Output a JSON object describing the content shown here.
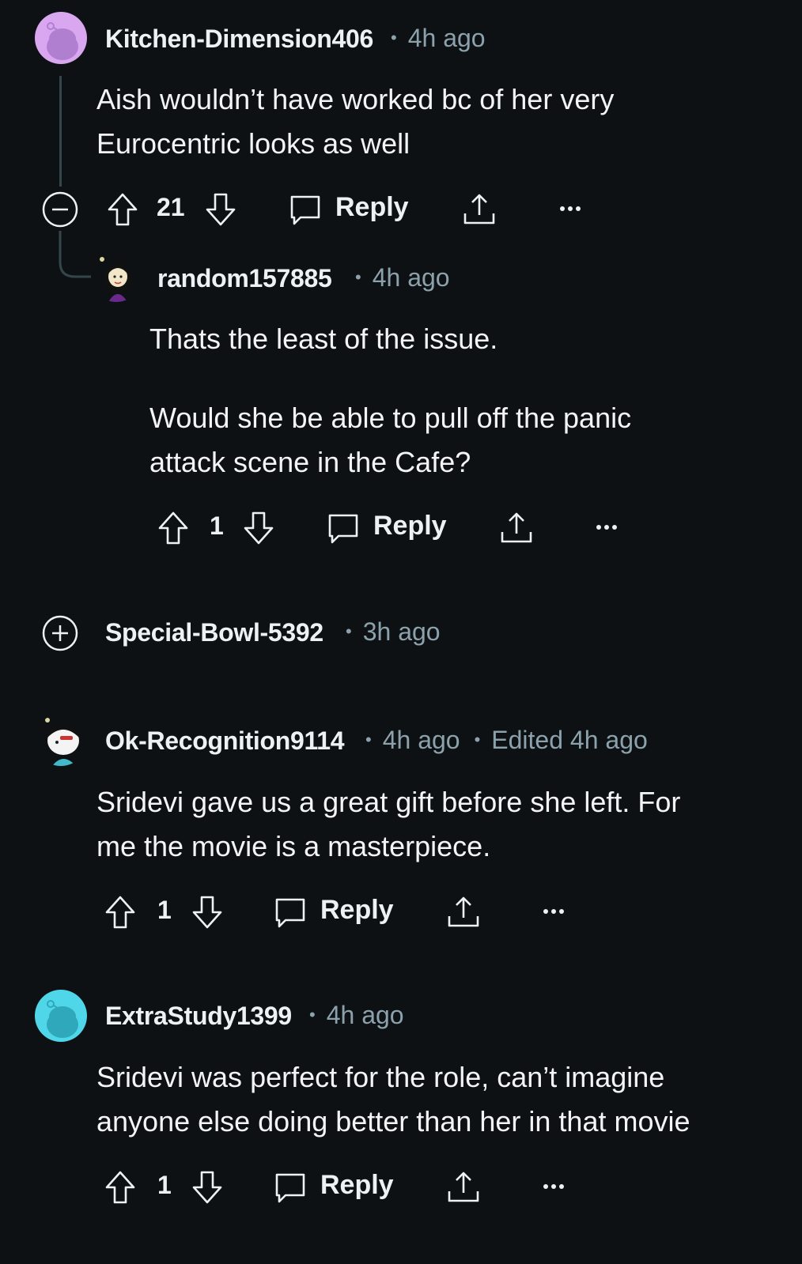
{
  "comments": [
    {
      "username": "Kitchen-Dimension406",
      "time": "4h ago",
      "body": [
        "Aish wouldn’t have worked bc of her very",
        "Eurocentric looks as well"
      ],
      "votes": "21",
      "reply_label": "Reply",
      "toggle": "collapse",
      "avatar_color": "#d9a6f0"
    },
    {
      "username": "random157885",
      "time": "4h ago",
      "body": [
        "Thats the least of the issue.",
        "",
        "Would she be able to pull off the panic",
        "attack scene in the Cafe?"
      ],
      "votes": "1",
      "reply_label": "Reply"
    },
    {
      "username": "Special-Bowl-5392",
      "time": "3h ago",
      "toggle": "expand"
    },
    {
      "username": "Ok-Recognition9114",
      "time": "4h ago",
      "edited": "Edited 4h ago",
      "body": [
        "Sridevi gave us a great gift before she left. For",
        "me the movie is a masterpiece."
      ],
      "votes": "1",
      "reply_label": "Reply"
    },
    {
      "username": "ExtraStudy1399",
      "time": "4h ago",
      "body": [
        "Sridevi was perfect for the role, can’t imagine",
        "anyone else doing better than her in that movie"
      ],
      "votes": "1",
      "reply_label": "Reply",
      "avatar_color": "#4fd6e8"
    }
  ],
  "colors": {
    "background": "#0e1113",
    "text": "#f2f4f5",
    "meta": "#8ba2ad",
    "thread_line": "#33464c"
  }
}
